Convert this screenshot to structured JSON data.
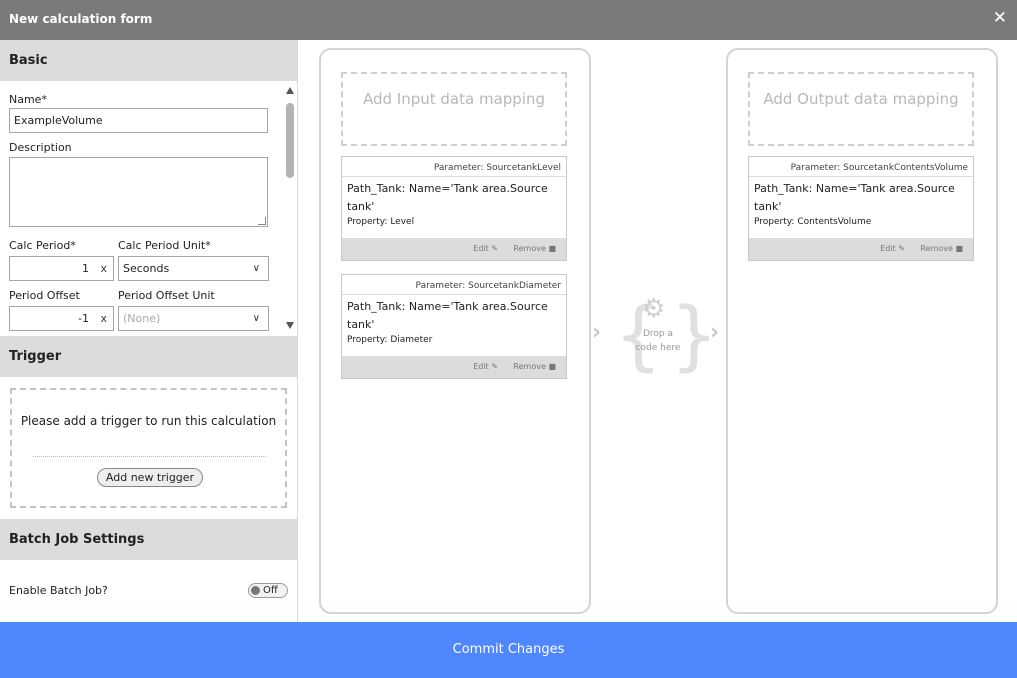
{
  "window": {
    "title": "New calculation form",
    "close_label": "✕"
  },
  "basic": {
    "heading": "Basic",
    "name_label": "Name*",
    "name_value": "ExampleVolume",
    "description_label": "Description",
    "calc_period_label": "Calc Period*",
    "calc_period_value": "1",
    "calc_period_unit_label": "Calc Period Unit*",
    "calc_period_unit_value": "Seconds",
    "period_offset_label": "Period Offset",
    "period_offset_value": "-1",
    "period_offset_unit_label": "Period Offset Unit",
    "period_offset_unit_value": "(None)",
    "clear_label": "x"
  },
  "trigger": {
    "heading": "Trigger",
    "empty_text": "Please add a trigger to run this calculation",
    "add_button": "Add new trigger"
  },
  "batch": {
    "heading": "Batch Job Settings",
    "enable_label": "Enable Batch Job?",
    "toggle_label": "Off"
  },
  "input": {
    "add_label": "Add Input data mapping",
    "mappings": [
      {
        "parameter": "Parameter: SourcetankLevel",
        "path": "Path_Tank: Name='Tank area.Source tank'",
        "property": "Property: Level",
        "edit": "Edit",
        "remove": "Remove"
      },
      {
        "parameter": "Parameter: SourcetankDiameter",
        "path": "Path_Tank: Name='Tank area.Source tank'",
        "property": "Property: Diameter",
        "edit": "Edit",
        "remove": "Remove"
      }
    ]
  },
  "code": {
    "drop_text": "Drop a code here"
  },
  "output": {
    "add_label": "Add Output data mapping",
    "mappings": [
      {
        "parameter": "Parameter: SourcetankContentsVolume",
        "path": "Path_Tank: Name='Tank area.Source tank'",
        "property": "Property: ContentsVolume",
        "edit": "Edit",
        "remove": "Remove"
      }
    ]
  },
  "footer": {
    "commit_label": "Commit Changes"
  },
  "colors": {
    "titlebar": "#7a7a7a",
    "section_header": "#dcdcdc",
    "commit": "#4f87ff"
  }
}
